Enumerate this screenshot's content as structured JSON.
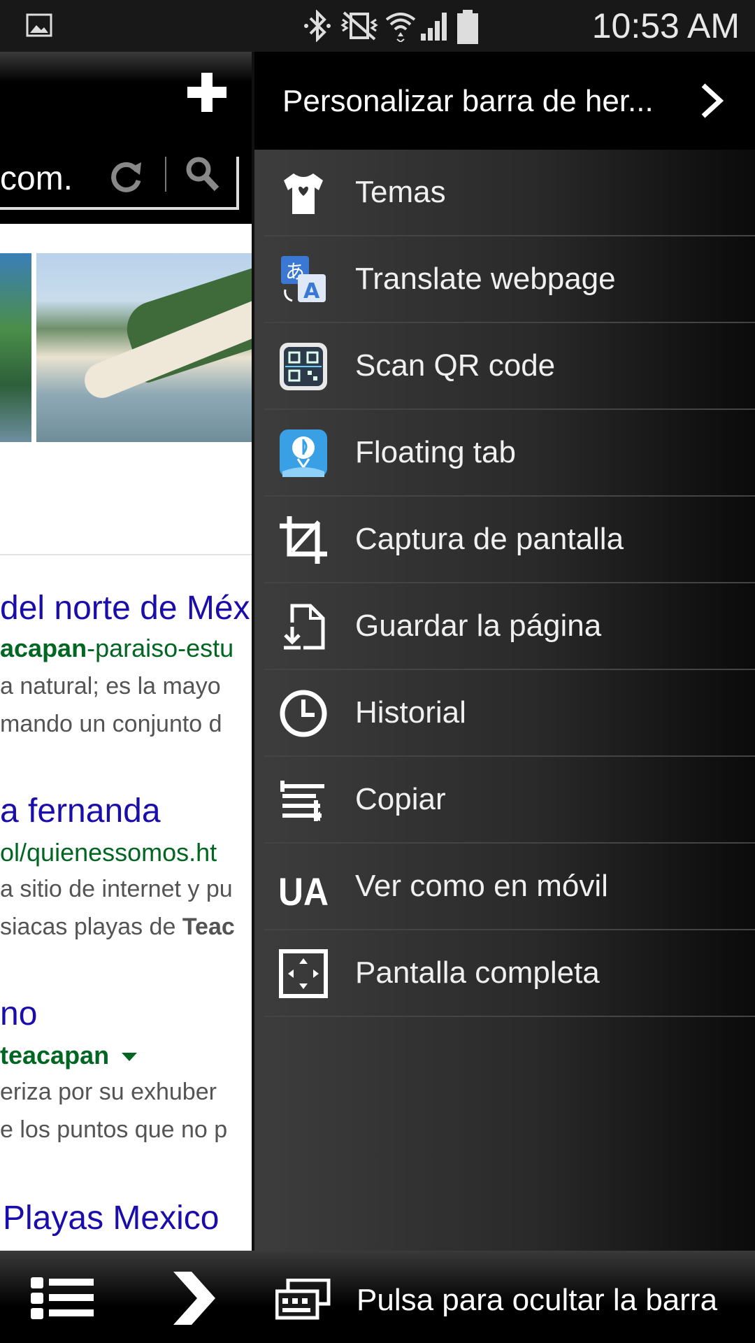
{
  "statusbar": {
    "time": "10:53 AM"
  },
  "browser": {
    "url_text": "com.",
    "results": [
      {
        "title": "del norte de Méx",
        "url_bold": "acapan",
        "url_rest": "-paraiso-estu",
        "snippet1": "a natural; es la mayo",
        "snippet2": "mando un conjunto d"
      },
      {
        "title": "a fernanda",
        "url": "ol/quienessomos.ht",
        "snippet1": "a sitio de internet y pu",
        "snippet2_pre": "siacas playas de ",
        "snippet2_bold": "Teac"
      },
      {
        "title": "no",
        "url_bold": "teacapan",
        "snippet1": "eriza por su exhuber",
        "snippet2": "e los puntos que no p"
      },
      {
        "title": "Playas Mexico"
      }
    ]
  },
  "drawer": {
    "title": "Personalizar barra de her...",
    "items": [
      {
        "label": "Temas",
        "icon": "tshirt-icon"
      },
      {
        "label": "Translate webpage",
        "icon": "translate-icon"
      },
      {
        "label": "Scan QR code",
        "icon": "qr-code-icon"
      },
      {
        "label": "Floating tab",
        "icon": "floating-tab-icon"
      },
      {
        "label": "Captura de pantalla",
        "icon": "crop-icon"
      },
      {
        "label": "Guardar la página",
        "icon": "save-page-icon"
      },
      {
        "label": "Historial",
        "icon": "clock-icon"
      },
      {
        "label": "Copiar",
        "icon": "copy-icon"
      },
      {
        "label": "Ver como en móvil",
        "icon": "ua-icon"
      },
      {
        "label": "Pantalla completa",
        "icon": "fullscreen-icon"
      }
    ]
  },
  "bottombar": {
    "label": "Pulsa para ocultar la barra"
  }
}
